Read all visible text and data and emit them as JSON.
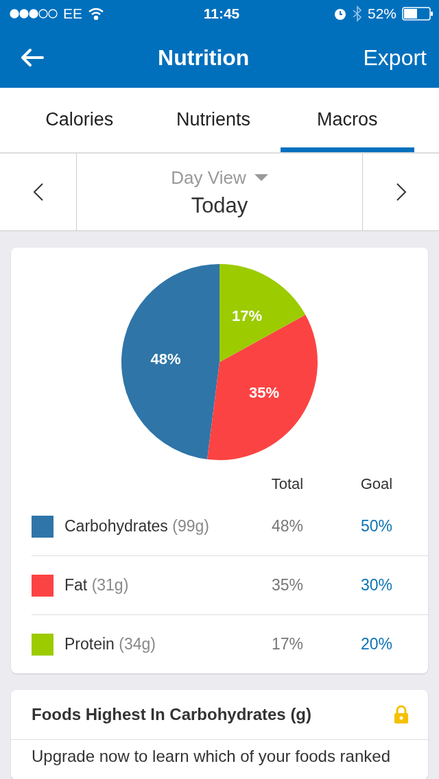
{
  "status_bar": {
    "carrier": "EE",
    "time": "11:45",
    "battery": "52%"
  },
  "nav_bar": {
    "title": "Nutrition",
    "action": "Export"
  },
  "tabs": [
    {
      "label": "Calories",
      "selected": false
    },
    {
      "label": "Nutrients",
      "selected": false
    },
    {
      "label": "Macros",
      "selected": true
    }
  ],
  "date_nav": {
    "view": "Day View",
    "date": "Today"
  },
  "macros_card": {
    "chart_data": {
      "type": "pie",
      "categories": [
        "Carbohydrates",
        "Fat",
        "Protein"
      ],
      "values": [
        48,
        35,
        17
      ],
      "data_labels": true,
      "value_labels": [
        "48%",
        "35%",
        "17%"
      ]
    },
    "columns": [
      "Total",
      "Goal"
    ],
    "rows": [
      {
        "amount": "(99g)",
        "total": "48%",
        "goal": "50%",
        "color": "#2f75a8"
      },
      {
        "amount": "(31g)",
        "total": "35%",
        "goal": "30%",
        "color": "#fc4343"
      },
      {
        "amount": "(34g)",
        "total": "17%",
        "goal": "20%",
        "color": "#9ccb00"
      }
    ]
  },
  "foods_card": {
    "title": "Foods Highest In Carbohydrates (g)",
    "text": "Upgrade now to learn which of your foods ranked"
  }
}
